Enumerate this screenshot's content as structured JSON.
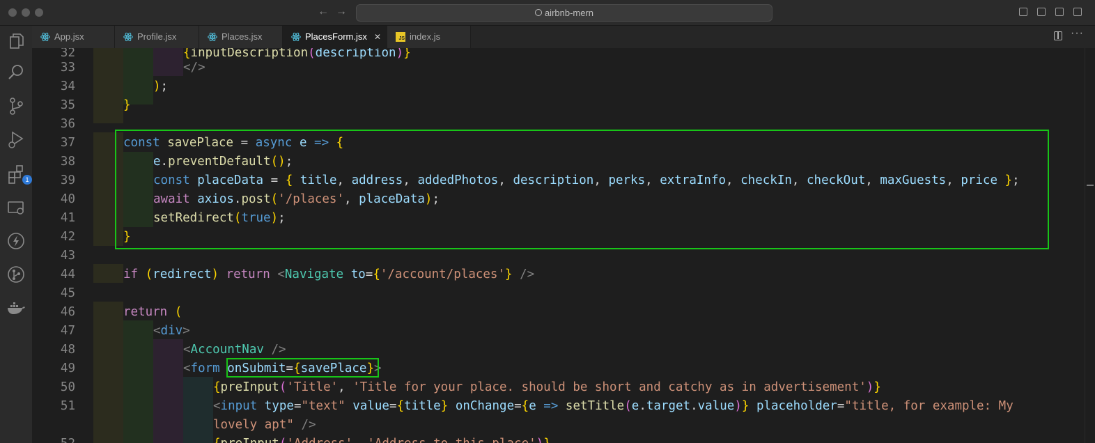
{
  "window": {
    "search_text": "airbnb-mern"
  },
  "tabs": [
    {
      "label": "App.jsx",
      "icon": "react-icon"
    },
    {
      "label": "Profile.jsx",
      "icon": "react-icon"
    },
    {
      "label": "Places.jsx",
      "icon": "react-icon"
    },
    {
      "label": "PlacesForm.jsx",
      "icon": "react-icon",
      "active": true
    },
    {
      "label": "index.js",
      "icon": "js-file-icon"
    }
  ],
  "activity_bar": {
    "items": [
      "explorer-icon",
      "search-icon",
      "source-control-icon",
      "run-debug-icon",
      "extensions-icon",
      "remote-explorer-icon",
      "lightning-icon",
      "git-graph-icon",
      "docker-icon"
    ],
    "extensions_badge": "1"
  },
  "editor": {
    "lines": [
      {
        "n": "32",
        "t": "{inputDescription(description)}"
      },
      {
        "n": "33",
        "t": "</>"
      },
      {
        "n": "34",
        "t": ");"
      },
      {
        "n": "35",
        "t": "}"
      },
      {
        "n": "36",
        "t": ""
      },
      {
        "n": "37",
        "t": "const savePlace = async e => {"
      },
      {
        "n": "38",
        "t": "e.preventDefault();"
      },
      {
        "n": "39",
        "t": "const placeData = { title, address, addedPhotos, description, perks, extraInfo, checkIn, checkOut, maxGuests, price };"
      },
      {
        "n": "40",
        "t": "await axios.post('/places', placeData);"
      },
      {
        "n": "41",
        "t": "setRedirect(true);"
      },
      {
        "n": "42",
        "t": "}"
      },
      {
        "n": "43",
        "t": ""
      },
      {
        "n": "44",
        "t": "if (redirect) return <Navigate to={'/account/places'} />"
      },
      {
        "n": "45",
        "t": ""
      },
      {
        "n": "46",
        "t": "return ("
      },
      {
        "n": "47",
        "t": "<div>"
      },
      {
        "n": "48",
        "t": "<AccountNav />"
      },
      {
        "n": "49",
        "t": "<form onSubmit={savePlace}>"
      },
      {
        "n": "50",
        "t": "{preInput('Title', 'Title for your place. should be short and catchy as in advertisement')}"
      },
      {
        "n": "51",
        "t": "<input type=\"text\" value={title} onChange={e => setTitle(e.target.value)} placeholder=\"title, for example: My lovely apt\" />"
      },
      {
        "n": "52",
        "t": "{preInput('Address', 'Address to this place')}"
      }
    ]
  },
  "colors": {
    "highlight_box": "#18c418",
    "keyword": "#569cd6",
    "control": "#c586c0",
    "variable": "#9cdcfe",
    "function": "#dcdcaa",
    "string": "#ce9178",
    "component": "#4ec9b0"
  }
}
